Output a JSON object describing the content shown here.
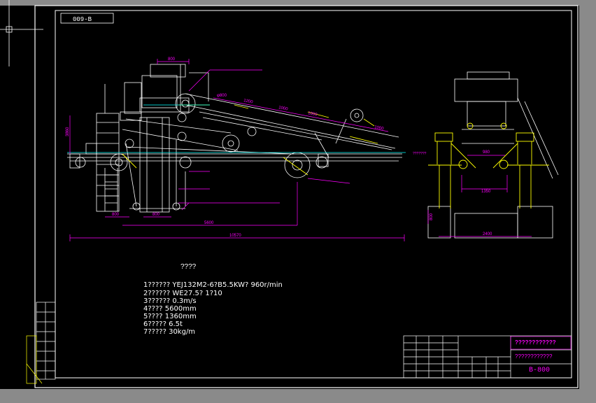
{
  "drawing_number_top": "009-B",
  "drawing_number_bottom": "B-800",
  "company_name": "????????????",
  "drawing_title": "????????????",
  "notes_title": "????",
  "notes": [
    "1?????? YEJ132M2-6?B5.5KW? 960r/min",
    "2?????? WE27.5? 1?10",
    "3?????? 0.3m/s",
    "4???? 5600mm",
    "5???? 1360mm",
    "6????? 6.5t",
    "7????? 30kg/m"
  ],
  "dimensions": {
    "top_width": "800",
    "pulley_dia": "φ800",
    "span_1": "1200",
    "span_2": "1000",
    "span_3": "1000",
    "span_4": "1000",
    "height": "3860",
    "left_base": "800",
    "mid_base": "800",
    "rail_length": "5600",
    "total_length": "10570",
    "side_width_1": "980",
    "side_width_2": "1350",
    "side_base": "2400",
    "side_left": "800"
  },
  "labels": {
    "side_callout": "???????"
  },
  "colors": {
    "white": "#ffffff",
    "magenta": "#ff00ff",
    "yellow": "#ffff00",
    "cyan": "#00ffff",
    "green": "#00ff00"
  }
}
